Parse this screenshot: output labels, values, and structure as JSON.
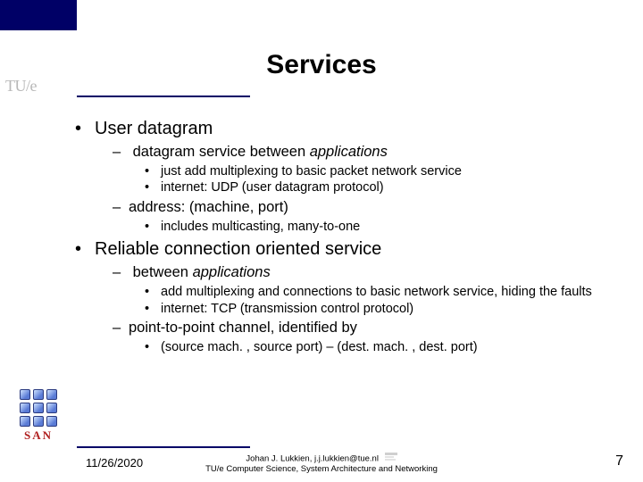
{
  "title": "Services",
  "logo_tue": "TU/e",
  "bullets": {
    "l1a": "User datagram",
    "l2a_pre": "datagram service between ",
    "l2a_em": "applications",
    "l3a": "just add multiplexing to basic packet network service",
    "l3b": "internet: UDP (user datagram protocol)",
    "l2b": "address: (machine, port)",
    "l3c": "includes multicasting, many-to-one",
    "l1b": "Reliable connection oriented service",
    "l2c_pre": "between ",
    "l2c_em": "applications",
    "l3d": "add multiplexing and connections to basic network service, hiding the faults",
    "l3e": "internet: TCP (transmission control protocol)",
    "l2d": "point-to-point channel, identified by",
    "l3f": "(source mach. , source port) – (dest. mach. , dest. port)"
  },
  "san_label": "SAN",
  "footer": {
    "date": "11/26/2020",
    "line1": "Johan J. Lukkien, j.j.lukkien@tue.nl",
    "line2": "TU/e Computer Science, System Architecture and Networking"
  },
  "page_number": "7"
}
